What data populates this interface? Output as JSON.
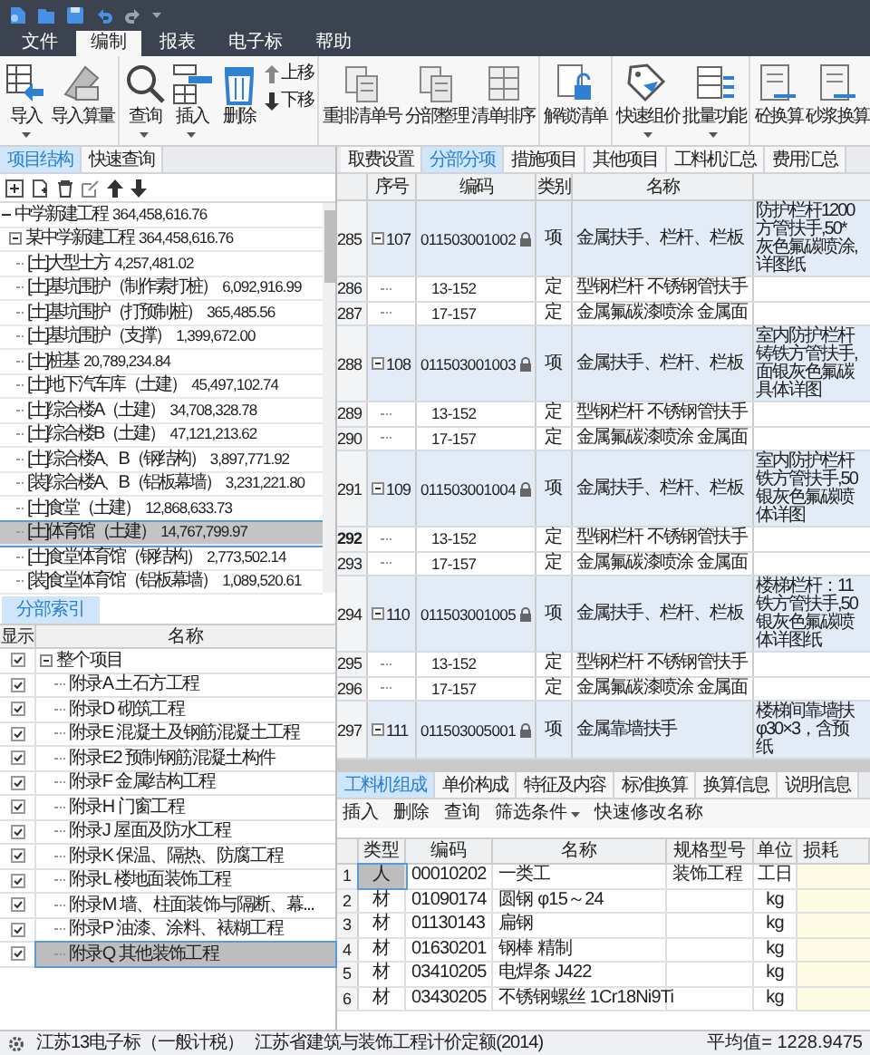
{
  "menu": [
    {
      "label": "文件",
      "selected": false
    },
    {
      "label": "编制",
      "selected": true
    },
    {
      "label": "报表",
      "selected": false
    },
    {
      "label": "电子标",
      "selected": false
    },
    {
      "label": "帮助",
      "selected": false
    }
  ],
  "ribbon": {
    "groups": [
      {
        "buttons": [
          {
            "kind": "large",
            "label": "导入",
            "dropdown": true
          },
          {
            "kind": "large",
            "label": "导入算量",
            "dropdown": false
          }
        ]
      },
      {
        "buttons": [
          {
            "kind": "large",
            "label": "查询",
            "dropdown": true
          },
          {
            "kind": "large",
            "label": "插入",
            "dropdown": true
          },
          {
            "kind": "large",
            "label": "删除",
            "dropdown": false
          },
          {
            "kind": "move",
            "labels": [
              "上移",
              "下移"
            ]
          }
        ]
      },
      {
        "buttons": [
          {
            "kind": "large",
            "label": "重排清单号",
            "dropdown": false
          },
          {
            "kind": "large",
            "label": "分部整理",
            "dropdown": false
          },
          {
            "kind": "large",
            "label": "清单排序",
            "dropdown": false
          }
        ]
      },
      {
        "buttons": [
          {
            "kind": "large",
            "label": "解锁清单",
            "dropdown": false
          }
        ]
      },
      {
        "buttons": [
          {
            "kind": "large",
            "label": "快速组价",
            "dropdown": true
          },
          {
            "kind": "large",
            "label": "批量功能",
            "dropdown": true
          }
        ]
      },
      {
        "buttons": [
          {
            "kind": "large",
            "label": "砼换算",
            "dropdown": false
          },
          {
            "kind": "large",
            "label": "砂浆换算",
            "dropdown": false
          }
        ]
      }
    ]
  },
  "left_panel": {
    "tabs": [
      {
        "label": "项目结构",
        "selected": true
      },
      {
        "label": "快速查询",
        "selected": false
      }
    ],
    "tree": [
      {
        "name": "中学新建工程",
        "amount": "364,458,616.76",
        "selected": false,
        "expanded": true,
        "children": [
          {
            "name": "某中学新建工程",
            "amount": "364,458,616.76",
            "selected": false,
            "expanded": true,
            "children": [
              {
                "name": "[土]大型土方",
                "amount": "4,257,481.02",
                "selected": false
              },
              {
                "name": "[土]基坑围护（制作素打桩）",
                "amount": "6,092,916.99",
                "selected": false
              },
              {
                "name": "[土]基坑围护（打预制桩）",
                "amount": "365,485.56",
                "selected": false
              },
              {
                "name": "[土]基坑围护（支撑）",
                "amount": "1,399,672.00",
                "selected": false
              },
              {
                "name": "[土]桩基",
                "amount": "20,789,234.84",
                "selected": false
              },
              {
                "name": "[土]地下汽车库（土建）",
                "amount": "45,497,102.74",
                "selected": false
              },
              {
                "name": "[土]综合楼A（土建）",
                "amount": "34,708,328.78",
                "selected": false
              },
              {
                "name": "[土]综合楼B（土建）",
                "amount": "47,121,213.62",
                "selected": false
              },
              {
                "name": "[土]综合楼A、B（钢结构）",
                "amount": "3,897,771.92",
                "selected": false
              },
              {
                "name": "[装]综合楼A、B（铝板幕墙）",
                "amount": "3,231,221.80",
                "selected": false
              },
              {
                "name": "[土]食堂（土建）",
                "amount": "12,868,633.73",
                "selected": false
              },
              {
                "name": "[土]体育馆（土建）",
                "amount": "14,767,799.97",
                "selected": true
              },
              {
                "name": "[土]食堂体育馆（钢结构）",
                "amount": "2,773,502.14",
                "selected": false
              },
              {
                "name": "[装]食堂体育馆（铝板幕墙）",
                "amount": "1,089,520.61",
                "selected": false
              }
            ]
          }
        ]
      }
    ],
    "index_tab": {
      "label": "分部索引",
      "selected": true
    },
    "index_grid": {
      "columns": [
        "显示",
        "名称"
      ],
      "rows": [
        {
          "name": "整个项目",
          "checked": true,
          "selected": false,
          "expanded": true,
          "children": [
            {
              "name": "附录A 土石方工程",
              "checked": true,
              "selected": false
            },
            {
              "name": "附录D 砌筑工程",
              "checked": true,
              "selected": false
            },
            {
              "name": "附录E 混凝土及钢筋混凝土工程",
              "checked": true,
              "selected": false
            },
            {
              "name": "附录E2 预制钢筋混凝土构件",
              "checked": true,
              "selected": false
            },
            {
              "name": "附录F 金属结构工程",
              "checked": true,
              "selected": false
            },
            {
              "name": "附录H 门窗工程",
              "checked": true,
              "selected": false
            },
            {
              "name": "附录J 屋面及防水工程",
              "checked": true,
              "selected": false
            },
            {
              "name": "附录K 保温、隔热、防腐工程",
              "checked": true,
              "selected": false
            },
            {
              "name": "附录L 楼地面装饰工程",
              "checked": true,
              "selected": false
            },
            {
              "name": "附录M 墙、柱面装饰与隔断、幕...",
              "checked": true,
              "selected": false
            },
            {
              "name": "附录P 油漆、涂料、裱糊工程",
              "checked": true,
              "selected": false
            },
            {
              "name": "附录Q 其他装饰工程",
              "checked": true,
              "selected": true
            }
          ]
        }
      ]
    }
  },
  "main": {
    "tabs": [
      {
        "label": "取费设置",
        "selected": false
      },
      {
        "label": "分部分项",
        "selected": true
      },
      {
        "label": "措施项目",
        "selected": false
      },
      {
        "label": "其他项目",
        "selected": false
      },
      {
        "label": "工料机汇总",
        "selected": false
      },
      {
        "label": "费用汇总",
        "selected": false
      }
    ],
    "table": {
      "columns": [
        "序号",
        "编码",
        "类别",
        "名称"
      ],
      "rows": [
        {
          "kind": "item",
          "row": "285",
          "seq": "107",
          "code": "011503001002",
          "locked": true,
          "category": "项",
          "name": "金属扶手、栏杆、栏板",
          "description": [
            "防护栏杆1200",
            "方管扶手,50*",
            "灰色氟碳喷涂,",
            "详图纸"
          ],
          "selected": false
        },
        {
          "kind": "quota",
          "row": "286",
          "code": "13-152",
          "category": "定",
          "name": "型钢栏杆 不锈钢管扶手",
          "selected": false
        },
        {
          "kind": "quota",
          "row": "287",
          "code": "17-157",
          "category": "定",
          "name": "金属氟碳漆喷涂 金属面",
          "selected": false
        },
        {
          "kind": "item",
          "row": "288",
          "seq": "108",
          "code": "011503001003",
          "locked": true,
          "category": "项",
          "name": "金属扶手、栏杆、栏板",
          "description": [
            "室内防护栏杆",
            "铸铁方管扶手,",
            "面银灰色氟碳",
            "具体详图"
          ],
          "selected": false
        },
        {
          "kind": "quota",
          "row": "289",
          "code": "13-152",
          "category": "定",
          "name": "型钢栏杆 不锈钢管扶手",
          "selected": false
        },
        {
          "kind": "quota",
          "row": "290",
          "code": "17-157",
          "category": "定",
          "name": "金属氟碳漆喷涂 金属面",
          "selected": false
        },
        {
          "kind": "item",
          "row": "291",
          "seq": "109",
          "code": "011503001004",
          "locked": true,
          "category": "项",
          "name": "金属扶手、栏杆、栏板",
          "description": [
            "室内防护栏杆",
            "铁方管扶手,50",
            "银灰色氟碳喷",
            "体详图"
          ],
          "selected": false
        },
        {
          "kind": "quota",
          "row": "292",
          "code": "13-152",
          "category": "定",
          "name": "型钢栏杆 不锈钢管扶手",
          "selected": true
        },
        {
          "kind": "quota",
          "row": "293",
          "code": "17-157",
          "category": "定",
          "name": "金属氟碳漆喷涂 金属面",
          "selected": false
        },
        {
          "kind": "item",
          "row": "294",
          "seq": "110",
          "code": "011503001005",
          "locked": true,
          "category": "项",
          "name": "金属扶手、栏杆、栏板",
          "description": [
            "楼梯栏杆：11",
            "铁方管扶手,50",
            "银灰色氟碳喷",
            "体详图纸"
          ],
          "selected": false
        },
        {
          "kind": "quota",
          "row": "295",
          "code": "13-152",
          "category": "定",
          "name": "型钢栏杆 不锈钢管扶手",
          "selected": false
        },
        {
          "kind": "quota",
          "row": "296",
          "code": "17-157",
          "category": "定",
          "name": "金属氟碳漆喷涂 金属面",
          "selected": false
        },
        {
          "kind": "item",
          "row": "297",
          "seq": "111",
          "code": "011503005001",
          "locked": true,
          "category": "项",
          "name": "金属靠墙扶手",
          "description": [
            "楼梯间靠墙扶",
            "φ30×3，含预",
            "纸"
          ],
          "selected": false
        }
      ]
    },
    "detail_tabs": [
      {
        "label": "工料机组成",
        "selected": true
      },
      {
        "label": "单价构成",
        "selected": false
      },
      {
        "label": "特征及内容",
        "selected": false
      },
      {
        "label": "标准换算",
        "selected": false
      },
      {
        "label": "换算信息",
        "selected": false
      },
      {
        "label": "说明信息",
        "selected": false
      }
    ],
    "detail_toolbar": [
      {
        "label": "插入",
        "dropdown": false
      },
      {
        "label": "删除",
        "dropdown": false
      },
      {
        "label": "查询",
        "dropdown": false
      },
      {
        "label": "筛选条件",
        "dropdown": true
      },
      {
        "label": "快速修改名称",
        "dropdown": false
      }
    ],
    "detail_grid": {
      "columns": [
        "类型",
        "编码",
        "名称",
        "规格型号",
        "单位",
        "损耗"
      ],
      "rows": [
        {
          "row": "1",
          "type": "人",
          "code": "00010202",
          "name": "一类工",
          "spec": "装饰工程",
          "unit": "工日",
          "selected": true
        },
        {
          "row": "2",
          "type": "材",
          "code": "01090174",
          "name": "圆钢 φ15～24",
          "unit": "kg",
          "selected": false
        },
        {
          "row": "3",
          "type": "材",
          "code": "01130143",
          "name": "扁钢",
          "unit": "kg",
          "selected": false
        },
        {
          "row": "4",
          "type": "材",
          "code": "01630201",
          "name": "钢棒 精制",
          "unit": "kg",
          "selected": false
        },
        {
          "row": "5",
          "type": "材",
          "code": "03410205",
          "name": "电焊条 J422",
          "unit": "kg",
          "selected": false
        },
        {
          "row": "6",
          "type": "材",
          "code": "03430205",
          "name": "不锈钢螺丝 1Cr18Ni9Ti",
          "unit": "kg",
          "selected": false
        }
      ]
    }
  },
  "status_bar": {
    "left": "江苏13电子标（一般计税）",
    "middle": "江苏省建筑与装饰工程计价定额(2014)",
    "right": "平均值= 1228.9475"
  }
}
